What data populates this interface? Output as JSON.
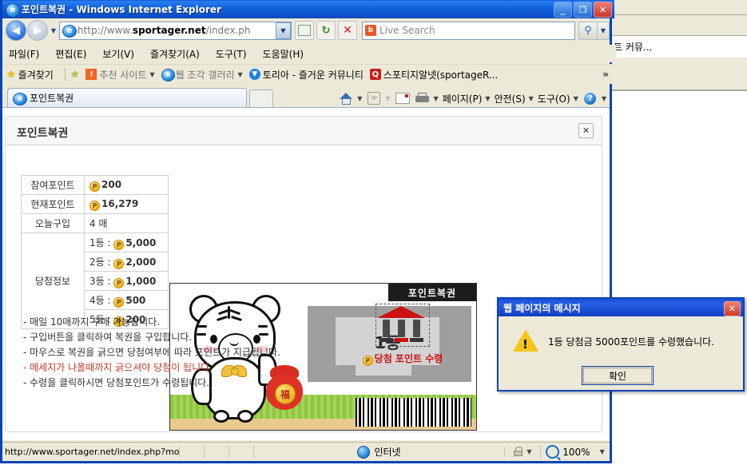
{
  "browser": {
    "title": "포인트복권 - Windows Internet Explorer",
    "title_icon": "ie-logo-icon",
    "window_buttons": {
      "minimize": "_",
      "maximize": "❐",
      "close": "✕"
    },
    "address": {
      "prefix": "http://www.",
      "domain": "sportager.net",
      "suffix": "/index.ph"
    },
    "search": {
      "placeholder": "Live Search"
    },
    "menu": [
      {
        "label": "파일(F)"
      },
      {
        "label": "편집(E)"
      },
      {
        "label": "보기(V)"
      },
      {
        "label": "즐겨찾기(A)"
      },
      {
        "label": "도구(T)"
      },
      {
        "label": "도움말(H)"
      }
    ],
    "favorites_bar": {
      "favorites_label": "즐겨찾기",
      "items": [
        {
          "label": "추천 사이트",
          "icon": "bulb-icon",
          "has_caret": true
        },
        {
          "label": "웹 조각 갤러리",
          "icon": "ie-logo-icon",
          "has_caret": true
        },
        {
          "label": "토리아 - 즐거운 커뮤니티",
          "icon": "blue-circle-icon",
          "has_caret": false
        },
        {
          "label": "스포티지알넷(sportageR...",
          "icon": "red-square-icon",
          "has_caret": false
        }
      ],
      "overflow": "»"
    },
    "tab": {
      "label": "포인트복권",
      "icon": "ie-logo-icon"
    },
    "command_bar": [
      {
        "label": "",
        "icon": "home-icon",
        "caret": true
      },
      {
        "label": "",
        "icon": "rss-feed-icon",
        "caret": true
      },
      {
        "label": "",
        "icon": "mail-icon",
        "caret": false
      },
      {
        "label": "",
        "icon": "printer-icon",
        "caret": true
      },
      {
        "label": "페이지(P)",
        "icon": "",
        "caret": true
      },
      {
        "label": "안전(S)",
        "icon": "",
        "caret": true
      },
      {
        "label": "도구(O)",
        "icon": "",
        "caret": true
      },
      {
        "label": "",
        "icon": "help-icon",
        "caret": true
      }
    ],
    "statusbar": {
      "url": "http://www.sportager.net/index.php?module=lot",
      "zone": "인터넷",
      "zoom": "100%"
    }
  },
  "background_window": {
    "text": "트 커뮤..."
  },
  "page": {
    "panel_title": "포인트복권",
    "close_label": "✕",
    "info_table": {
      "rows": [
        {
          "label": "참여포인트",
          "value": "200",
          "coin": true,
          "bold": true
        },
        {
          "label": "현재포인트",
          "value": "16,279",
          "coin": true,
          "bold": true
        },
        {
          "label": "오늘구입",
          "value": "4 매",
          "coin": false,
          "bold": false
        }
      ],
      "prize_label": "당첨정보",
      "prizes": [
        {
          "rank": "1등 : ",
          "value": "5,000"
        },
        {
          "rank": "2등 : ",
          "value": "2,000"
        },
        {
          "rank": "3등 : ",
          "value": "1,000"
        },
        {
          "rank": "4등 : ",
          "value": "500"
        },
        {
          "rank": "5등 : ",
          "value": "200"
        }
      ]
    },
    "ticket": {
      "banner": "포인트복권",
      "revealed_rank": "1등",
      "mascot": "white-tiger-mascot",
      "lucky_pouch_char": "福"
    },
    "notes": [
      {
        "text": "- 매일 10매까지 구매 가능합니다.",
        "style": "normal"
      },
      {
        "text": "- 구입버튼을 클릭하여 복권을 구입합니다.",
        "style": "normal"
      },
      {
        "text": "- 마우스로 복권을 긁으면 당첨여부에 따라 포인트가 지급됩니다.",
        "style": "normal"
      },
      {
        "text": "- 메세지가 나올때까지 긁으셔야 당첨이 됩니다.",
        "style": "red"
      },
      {
        "text": "- 수령을 클릭하시면 당첨포인트가 수령됩니다.",
        "style": "bold-lead"
      }
    ],
    "receive": {
      "label": "당첨 포인트 수령",
      "icon": "bank-icon"
    }
  },
  "dialog": {
    "title": "웹 페이지의 메시지",
    "close_label": "✕",
    "icon": "warning-triangle-icon",
    "warn_mark": "!",
    "message": "1등 당첨금 5000포인트를 수령했습니다.",
    "ok_label": "확인"
  },
  "colors": {
    "titlebar_blue": "#0a44b4",
    "dialog_blue": "#1a4fd8",
    "accent_red": "#cc1111",
    "coin_gold": "#f4b81e",
    "grass_green": "#8dc63f",
    "sand": "#e8c98e"
  }
}
